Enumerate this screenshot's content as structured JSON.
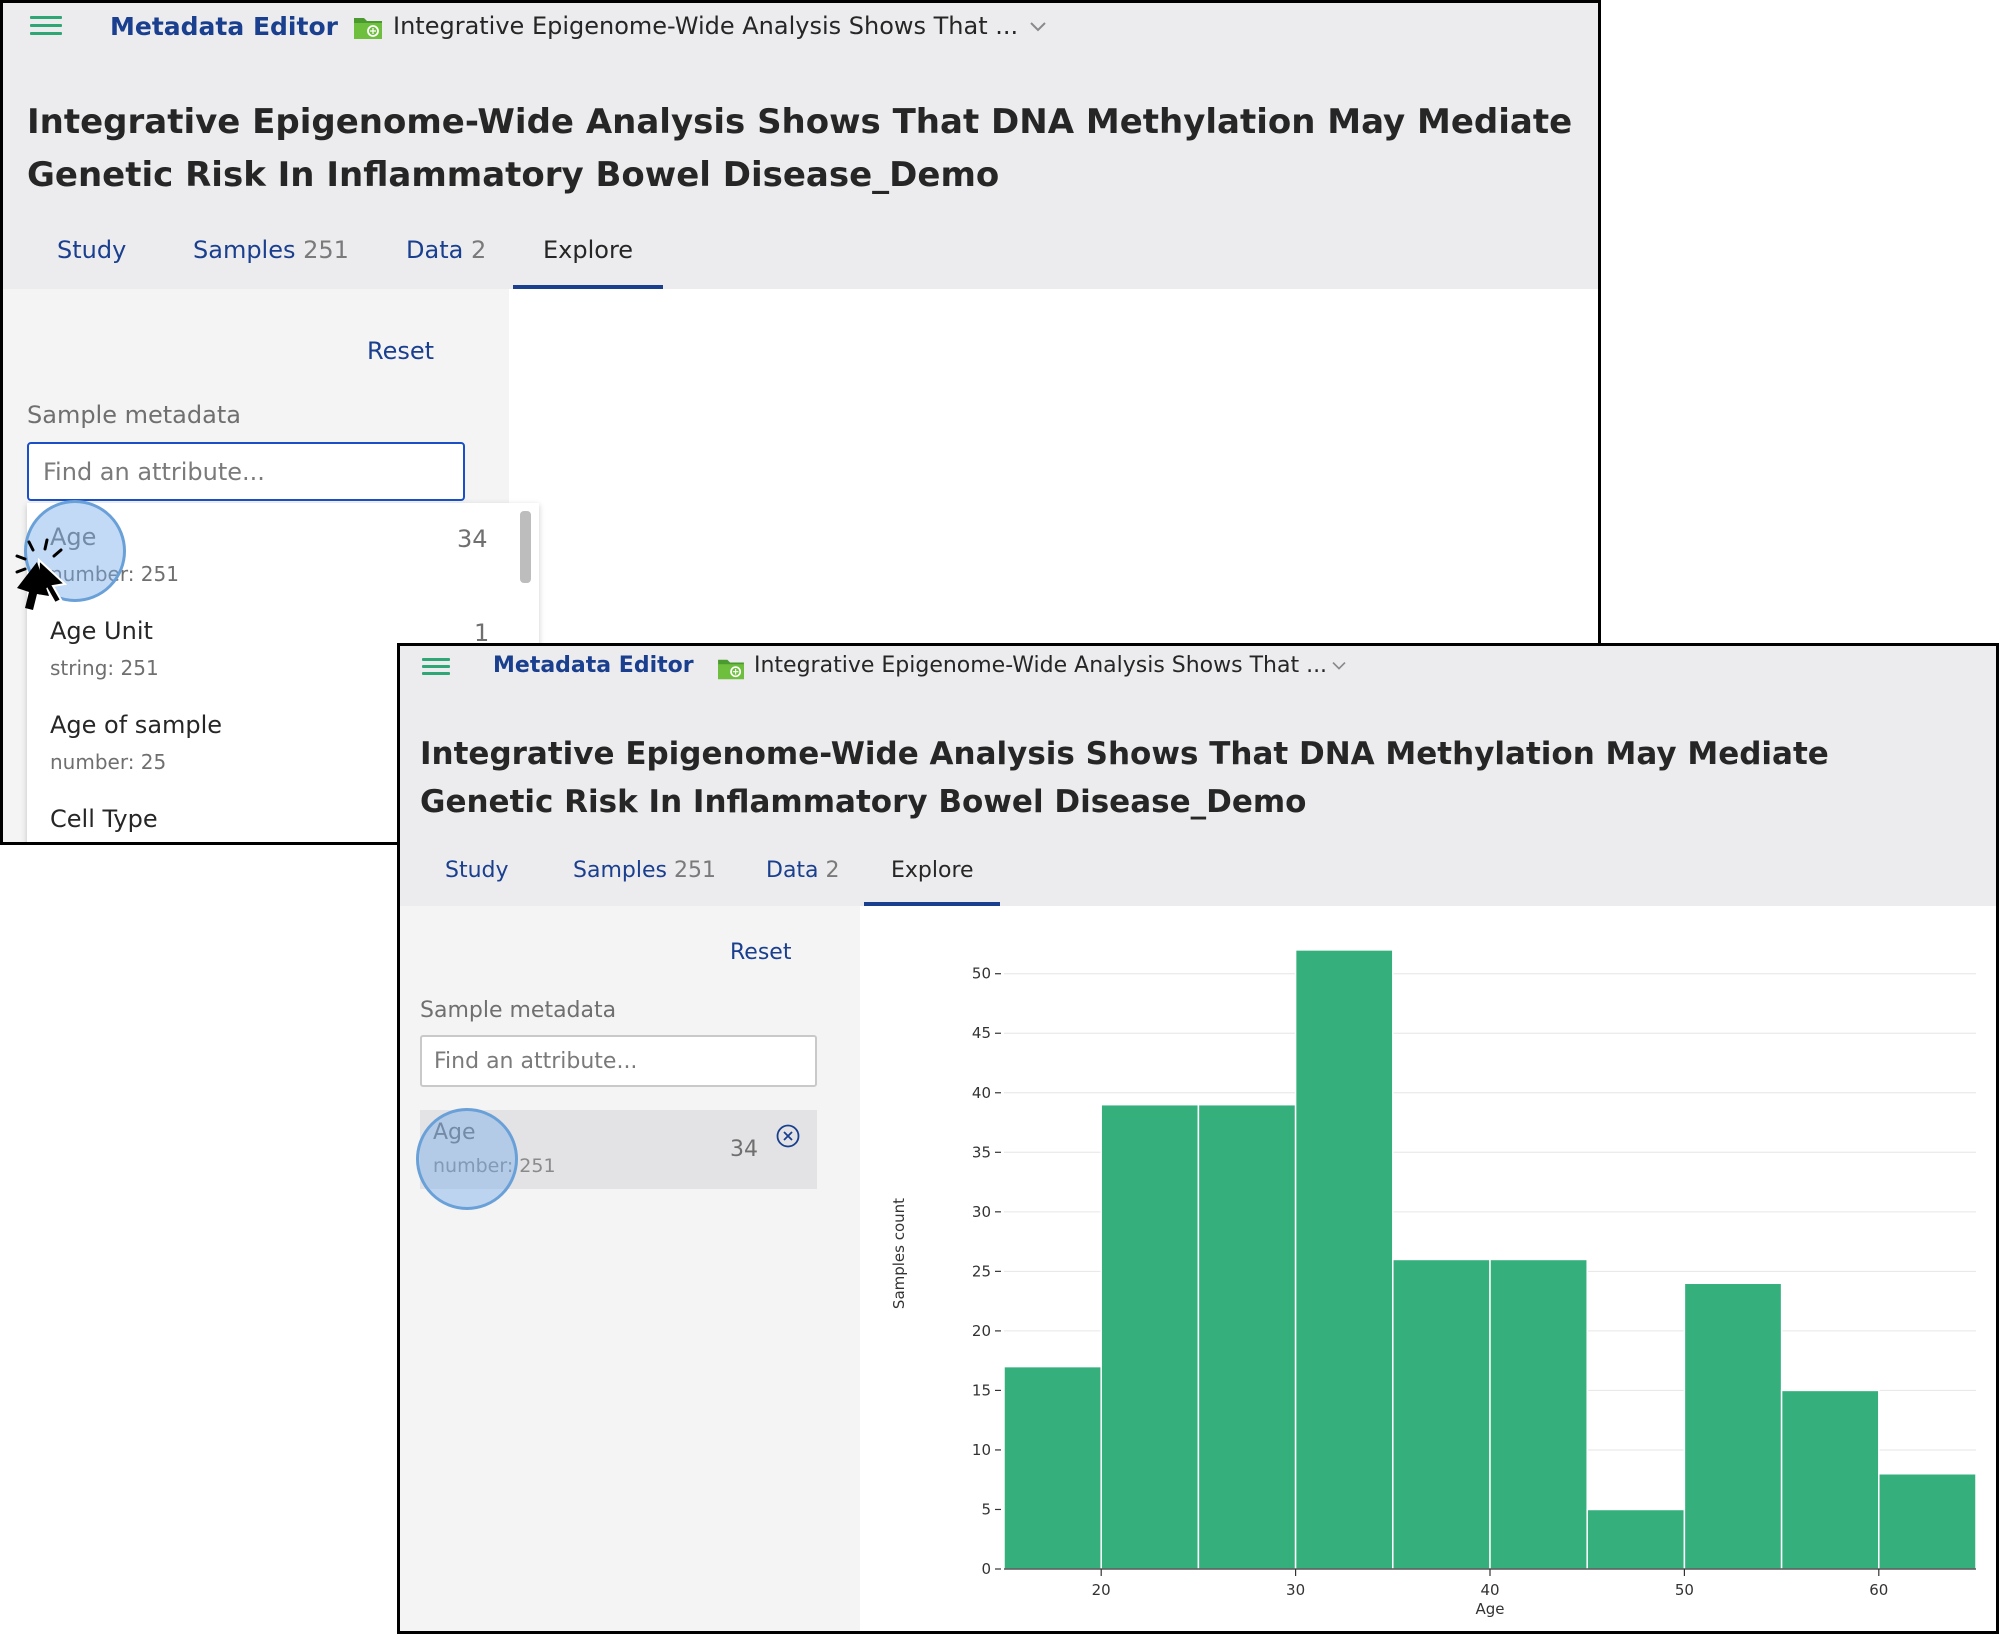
{
  "app": {
    "name": "Metadata Editor",
    "study_selector": "Integrative Epigenome-Wide Analysis Shows That ...",
    "study_title": "Integrative Epigenome-Wide Analysis Shows That DNA Methylation May Mediate Genetic Risk In Inflammatory Bowel Disease_Demo"
  },
  "tabs": [
    {
      "label": "Study",
      "count": ""
    },
    {
      "label": "Samples",
      "count": "251"
    },
    {
      "label": "Data",
      "count": "2"
    },
    {
      "label": "Explore",
      "count": ""
    }
  ],
  "active_tab": "Explore",
  "sidebar": {
    "reset_label": "Reset",
    "section_label": "Sample metadata",
    "search_placeholder": "Find an attribute..."
  },
  "dropdown_items": [
    {
      "name": "Age",
      "type": "number: 251",
      "count": "34"
    },
    {
      "name": "Age Unit",
      "type": "string: 251",
      "count": "1"
    },
    {
      "name": "Age of sample",
      "type": "number: 25",
      "count": ""
    },
    {
      "name": "Cell Type",
      "type": "",
      "count": ""
    }
  ],
  "selected_attribute": {
    "name": "Age",
    "type": "number: 251",
    "count": "34"
  },
  "colors": {
    "accent": "#1a3f8f",
    "bar": "#35b07c",
    "header_bg": "#ececee",
    "sidebar_bg": "#f4f4f4"
  },
  "icons": {
    "menu": "hamburger-menu-icon",
    "study": "folder-icon",
    "dropdown": "chevron-down-icon",
    "remove": "close-circle-icon"
  },
  "chart_data": {
    "type": "bar",
    "xlabel": "Age",
    "ylabel": "Samples count",
    "bin_edges": [
      15,
      20,
      25,
      30,
      35,
      40,
      45,
      50,
      55,
      60,
      65
    ],
    "values": [
      17,
      39,
      39,
      52,
      26,
      26,
      5,
      24,
      15,
      8
    ],
    "xlim": [
      15,
      65
    ],
    "ylim": [
      0,
      53
    ],
    "xticks": [
      20,
      30,
      40,
      50,
      60
    ],
    "yticks": [
      0,
      5,
      10,
      15,
      20,
      25,
      30,
      35,
      40,
      45,
      50
    ],
    "grid": true
  }
}
